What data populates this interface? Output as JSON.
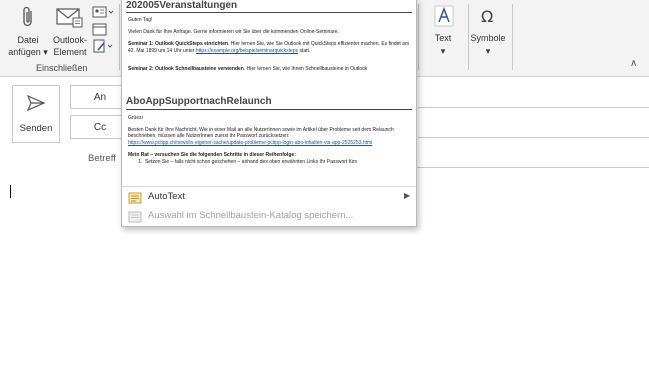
{
  "ribbon": {
    "attach_file": {
      "line1": "Datei",
      "line2": "anfügen",
      "icon": "paperclip-icon"
    },
    "outlook_item": {
      "line1": "Outlook-",
      "line2": "Element",
      "icon": "envelope-icon"
    },
    "group_include": "Einschließen",
    "text_button": "Text",
    "symbols_button": "Symbole",
    "colors": {
      "accent": "#2b579a",
      "ribbon_bg": "#f3f3f3"
    }
  },
  "compose": {
    "send_label": "Senden",
    "to_label": "An",
    "cc_label": "Cc",
    "subject_label": "Betreff"
  },
  "quickparts": {
    "item1": {
      "title": "202005Veranstaltungen",
      "greeting": "Guten Tag!",
      "line1": "Vielen Dank für Ihre Anfrage. Gerne informieren wir Sie über die kommenden Online-Seminare.",
      "sem1_bold": "Seminar 1: Outlook QuickSteps einrichten",
      "sem1_text": ". Hier lernen Sie, wie Sie Outlook mit QuickSteps effizienter machen. Es findet am 42. Mai 1899 um 14 Uhr unter",
      "sem1_link": "https://example.org/beispielseminarquicksteps",
      "sem1_tail": "statt.",
      "sem2_bold": "Seminar 2: Outlook Schnellbausteine verwenden",
      "sem2_text": ". Hier lernen Sie, wie Ihnen Schnellbausteine in Outlook"
    },
    "item2": {
      "title": "AboAppSupportnachRelaunch",
      "greeting": "Grüezi",
      "para": "Besten Dank für Ihre Nachricht. Wie in einer Mail an alle NutzerInnen sowie im Artikel über Probleme seit dem Relaunch beschrieben, müssen alle NutzerInnen zuerst ihr Passwort zurücksetzen:",
      "link": "https://www.pctipp.ch/news/in-eigener-sache/update-probleme-pctipp-login-abo-inhalten-via-app-2525253.html",
      "advice_bold": "Mein Rat – versuchen Sie die folgenden Schritte in dieser Reihenfolge:",
      "step1": "Setzen Sie – falls nicht schon geschehen – anhand des oben erwähnten Links Ihr Passwort fürs"
    },
    "menu": {
      "autotext": "AutoText",
      "save_selection": "Auswahl im Schnellbaustein-Katalog speichern..."
    }
  }
}
